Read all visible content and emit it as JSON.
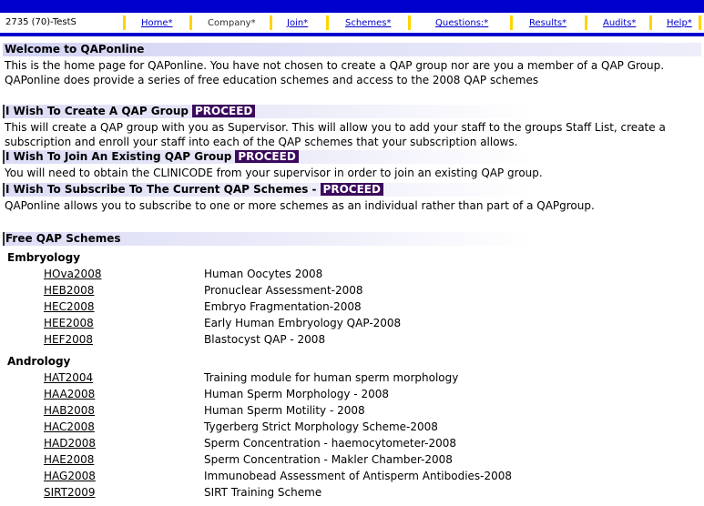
{
  "nav": {
    "user": "2735 (70)-TestS",
    "links": [
      {
        "label": "Home*",
        "plain": false
      },
      {
        "label": "Company*",
        "plain": true
      },
      {
        "label": "Join*",
        "plain": false
      },
      {
        "label": "Schemes*",
        "plain": false
      },
      {
        "label": "Questions:*",
        "plain": false
      },
      {
        "label": "Results*",
        "plain": false
      },
      {
        "label": "Audits*",
        "plain": false
      },
      {
        "label": "Help*",
        "plain": false
      }
    ]
  },
  "welcome": {
    "title": "Welcome to QAPonline",
    "text": "This is the home page for QAPonline. You have not chosen to create a QAP group nor are you a member of a QAP Group. QAPonline does provide a series of free education schemes and access to the 2008 QAP schemes"
  },
  "create": {
    "title": "I Wish To Create A QAP Group",
    "proceed": "PROCEED",
    "text": "This will create a QAP group with you as Supervisor. This will allow you to add your staff to the groups Staff List, create a subscription and enroll your staff into each of the QAP schemes that your subscription allows."
  },
  "join": {
    "title": "I Wish To Join An Existing QAP Group",
    "proceed": "PROCEED",
    "text": "You will need to obtain the CLINICODE from your supervisor in order to join an existing QAP group."
  },
  "subscribe": {
    "title": "I Wish To Subscribe To The Current QAP Schemes -",
    "proceed": "PROCEED",
    "text": "QAPonline allows you to subscribe to one or more schemes as an individual rather than part of a QAPgroup."
  },
  "free": {
    "title": "Free QAP Schemes",
    "categories": [
      {
        "name": "Embryology",
        "schemes": [
          {
            "code": "HOva2008",
            "desc": "Human Oocytes 2008"
          },
          {
            "code": "HEB2008",
            "desc": "Pronuclear Assessment-2008"
          },
          {
            "code": "HEC2008",
            "desc": "Embryo Fragmentation-2008"
          },
          {
            "code": "HEE2008",
            "desc": "Early Human Embryology QAP-2008"
          },
          {
            "code": "HEF2008",
            "desc": "Blastocyst QAP - 2008"
          }
        ]
      },
      {
        "name": "Andrology",
        "schemes": [
          {
            "code": "HAT2004",
            "desc": "Training module for human sperm morphology"
          },
          {
            "code": "HAA2008",
            "desc": "Human Sperm Morphology - 2008"
          },
          {
            "code": "HAB2008",
            "desc": "Human Sperm Motility - 2008"
          },
          {
            "code": "HAC2008",
            "desc": "Tygerberg Strict Morphology Scheme-2008"
          },
          {
            "code": "HAD2008",
            "desc": "Sperm Concentration - haemocytometer-2008"
          },
          {
            "code": "HAE2008",
            "desc": "Sperm Concentration - Makler Chamber-2008"
          },
          {
            "code": "HAG2008",
            "desc": "Immunobead Assessment of Antisperm Antibodies-2008"
          },
          {
            "code": "SIRT2009",
            "desc": "SIRT Training Scheme"
          }
        ]
      }
    ]
  }
}
